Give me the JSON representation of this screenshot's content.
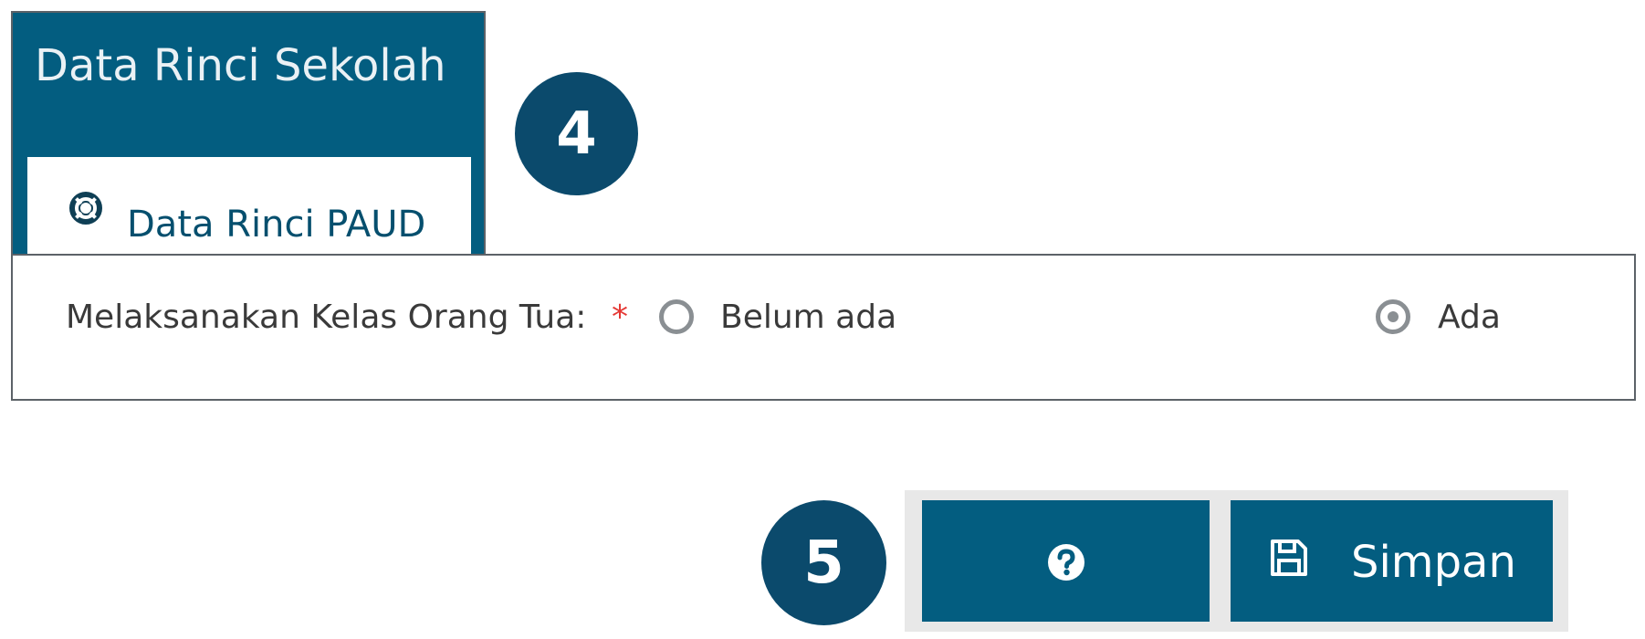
{
  "header": {
    "title": "Data Rinci Sekolah",
    "tab_label": "Data Rinci PAUD",
    "tab_icon": "life-ring-icon"
  },
  "badges": {
    "first": "4",
    "second": "5"
  },
  "form": {
    "field_label": "Melaksanakan Kelas Orang Tua:",
    "required_mark": "*",
    "options": [
      {
        "label": "Belum ada",
        "selected": false
      },
      {
        "label": "Ada",
        "selected": true
      }
    ]
  },
  "buttons": {
    "help_icon": "question-circle-icon",
    "save_icon": "floppy-disk-icon",
    "save_label": "Simpan"
  },
  "colors": {
    "primary": "#035d80",
    "badge": "#0b4a6c",
    "required": "#e53935"
  }
}
